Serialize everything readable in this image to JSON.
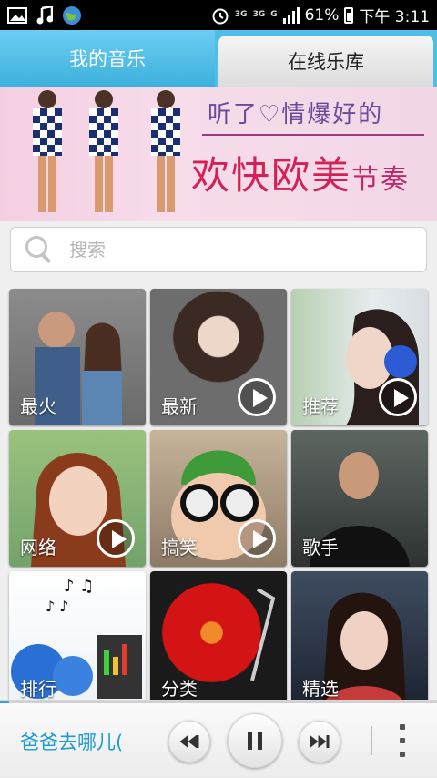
{
  "statusbar": {
    "battery": "61%",
    "time": "下午 3:11",
    "net1": "3G",
    "net2": "3G",
    "net3": "G"
  },
  "tabs": [
    {
      "label": "我的音乐",
      "active": false
    },
    {
      "label": "在线乐库",
      "active": true
    }
  ],
  "banner": {
    "line1": "听了♡情爆好的",
    "line2a": "欢快",
    "line2b": "欧美",
    "line2c": "节奏",
    "page_count": 9,
    "active_page": 2
  },
  "search": {
    "placeholder": "搜索"
  },
  "categories": [
    {
      "label": "最火",
      "has_play": false
    },
    {
      "label": "最新",
      "has_play": true
    },
    {
      "label": "推荐",
      "has_play": true
    },
    {
      "label": "网络",
      "has_play": true
    },
    {
      "label": "搞笑",
      "has_play": true
    },
    {
      "label": "歌手",
      "has_play": false
    },
    {
      "label": "排行",
      "has_play": false
    },
    {
      "label": "分类",
      "has_play": false
    },
    {
      "label": "精选",
      "has_play": false
    }
  ],
  "player": {
    "song_title": "爸爸去哪儿(",
    "progress": 0.02,
    "state": "playing"
  },
  "colors": {
    "accent": "#4ebee6",
    "song_text": "#1d9ad1"
  }
}
